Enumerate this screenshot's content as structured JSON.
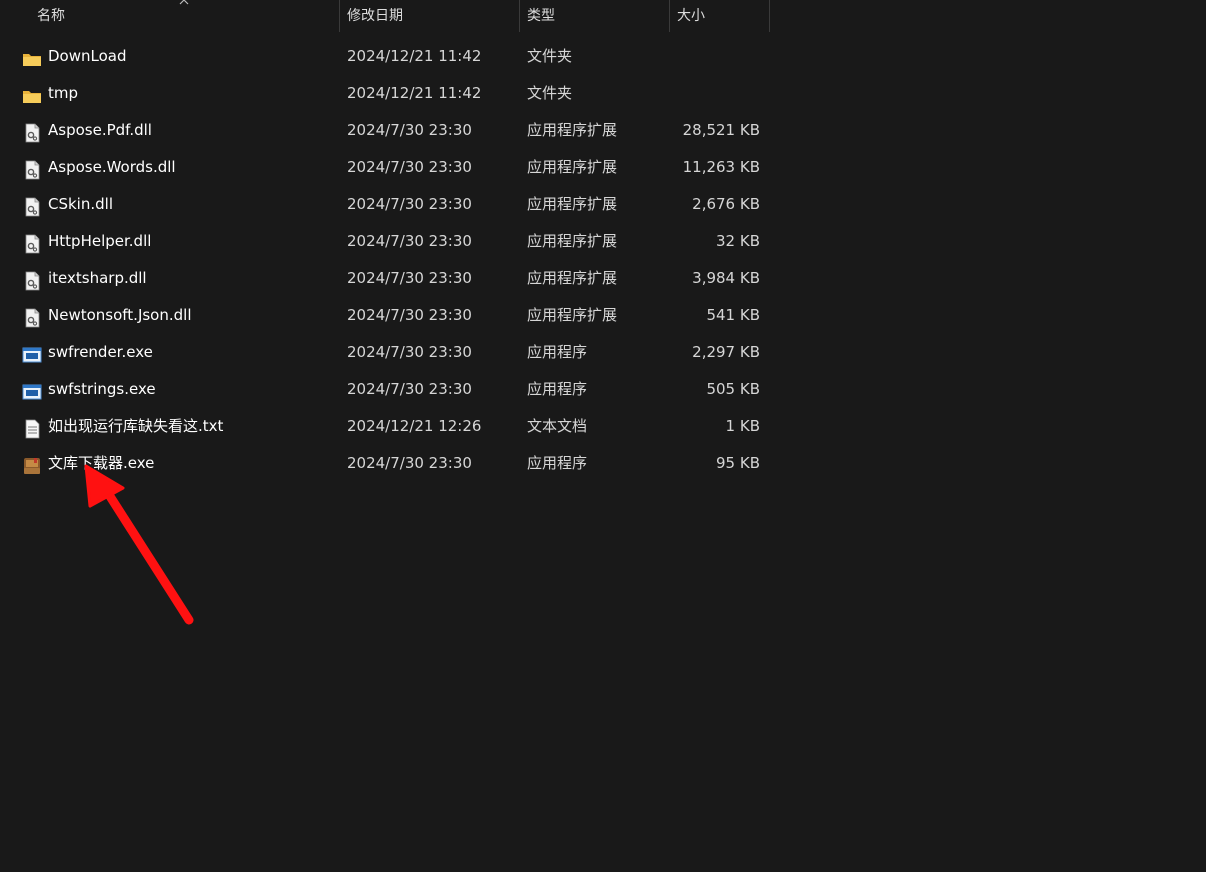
{
  "columns": {
    "name": "名称",
    "date": "修改日期",
    "type": "类型",
    "size": "大小",
    "sort_icon": "chevron-up-icon"
  },
  "files": [
    {
      "icon": "folder-icon",
      "name": "DownLoad",
      "date": "2024/12/21 11:42",
      "type": "文件夹",
      "size": ""
    },
    {
      "icon": "folder-icon",
      "name": "tmp",
      "date": "2024/12/21 11:42",
      "type": "文件夹",
      "size": ""
    },
    {
      "icon": "dll-icon",
      "name": "Aspose.Pdf.dll",
      "date": "2024/7/30 23:30",
      "type": "应用程序扩展",
      "size": "28,521 KB"
    },
    {
      "icon": "dll-icon",
      "name": "Aspose.Words.dll",
      "date": "2024/7/30 23:30",
      "type": "应用程序扩展",
      "size": "11,263 KB"
    },
    {
      "icon": "dll-icon",
      "name": "CSkin.dll",
      "date": "2024/7/30 23:30",
      "type": "应用程序扩展",
      "size": "2,676 KB"
    },
    {
      "icon": "dll-icon",
      "name": "HttpHelper.dll",
      "date": "2024/7/30 23:30",
      "type": "应用程序扩展",
      "size": "32 KB"
    },
    {
      "icon": "dll-icon",
      "name": "itextsharp.dll",
      "date": "2024/7/30 23:30",
      "type": "应用程序扩展",
      "size": "3,984 KB"
    },
    {
      "icon": "dll-icon",
      "name": "Newtonsoft.Json.dll",
      "date": "2024/7/30 23:30",
      "type": "应用程序扩展",
      "size": "541 KB"
    },
    {
      "icon": "exe-icon",
      "name": "swfrender.exe",
      "date": "2024/7/30 23:30",
      "type": "应用程序",
      "size": "2,297 KB"
    },
    {
      "icon": "exe-icon",
      "name": "swfstrings.exe",
      "date": "2024/7/30 23:30",
      "type": "应用程序",
      "size": "505 KB"
    },
    {
      "icon": "txt-icon",
      "name": "如出现运行库缺失看这.txt",
      "date": "2024/12/21 12:26",
      "type": "文本文档",
      "size": "1 KB"
    },
    {
      "icon": "app-book-icon",
      "name": "文库下载器.exe",
      "date": "2024/7/30 23:30",
      "type": "应用程序",
      "size": "95 KB"
    }
  ],
  "annotation": {
    "icon": "red-arrow-annotation",
    "color": "#ff1111"
  },
  "colors": {
    "background": "#191919",
    "text": "#ffffff",
    "muted_text": "#d6d6d6",
    "folder": "#f4c542"
  }
}
